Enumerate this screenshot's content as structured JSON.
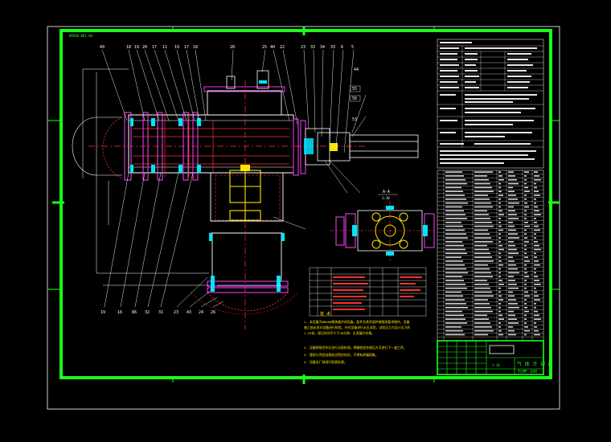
{
  "drawing": {
    "title_block": {
      "title": "气 体 冷 却 器",
      "drawing_no": "TCMF-100",
      "scale": "1:10"
    },
    "notes_heading": "技 术",
    "notes": [
      "1.  本设备为DN500换热器冷却设备，配件及其余部件按图纸要求制作，设备",
      "    施工前必须对设备进行检验，并对设备进行水压试验，试验压力为设计压力的",
      "    1.25倍，保压时间不少于30分钟，无泄漏为合格。",
      "2.  设备焊接完毕后进行无损检测，焊缝检验合格后方可进行下一道工序。",
      "3.  管程与壳程连接处应密封良好，不得有渗漏现象。",
      "4.  设备出厂前进行防腐处理。"
    ],
    "balloons_top": [
      "49",
      "18",
      "19",
      "20",
      "17",
      "11",
      "19",
      "17",
      "18",
      "28",
      "25",
      "40",
      "22",
      "23",
      "33",
      "34",
      "33",
      "6",
      "5"
    ],
    "balloons_bottom": [
      "19",
      "16",
      "86",
      "32",
      "31",
      "23",
      "43",
      "24",
      "26"
    ],
    "label_44": "44",
    "label_53": "53",
    "label_55": "55",
    "label_56": "56",
    "section_label": "A-A",
    "section_scale": "1:10",
    "frame_tag": "DN500-001-A0"
  }
}
